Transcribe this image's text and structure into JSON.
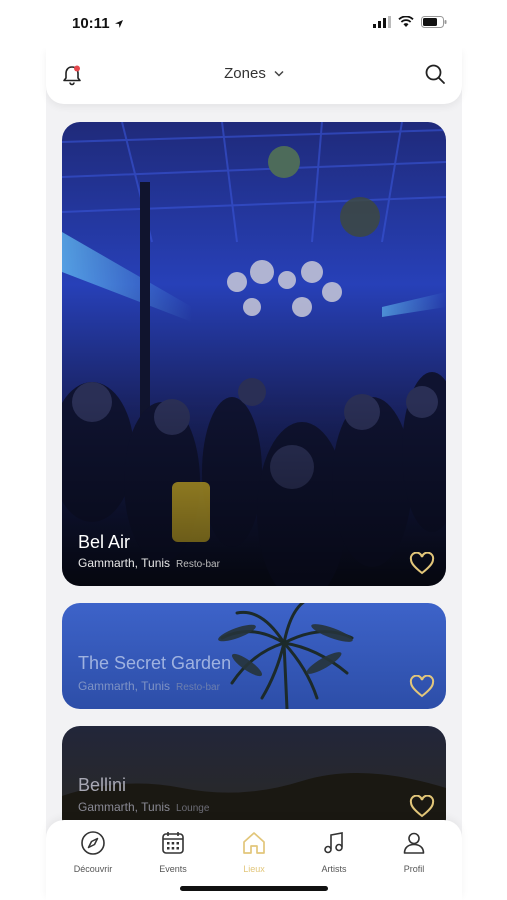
{
  "status": {
    "time": "10:11"
  },
  "header": {
    "zones_label": "Zones"
  },
  "cards": [
    {
      "title": "Bel Air",
      "location": "Gammarth, Tunis",
      "category": "Resto-bar"
    },
    {
      "title": "The Secret Garden",
      "location": "Gammarth, Tunis",
      "category": "Resto-bar"
    },
    {
      "title": "Bellini",
      "location": "Gammarth, Tunis",
      "category": "Lounge"
    }
  ],
  "tabs": [
    {
      "label": "Découvrir",
      "icon": "compass-icon"
    },
    {
      "label": "Events",
      "icon": "calendar-icon"
    },
    {
      "label": "Lieux",
      "icon": "home-icon"
    },
    {
      "label": "Artists",
      "icon": "music-note-icon"
    },
    {
      "label": "Profil",
      "icon": "user-icon"
    }
  ],
  "colors": {
    "accent": "#e2c67a",
    "notification_dot": "#e5484d"
  }
}
